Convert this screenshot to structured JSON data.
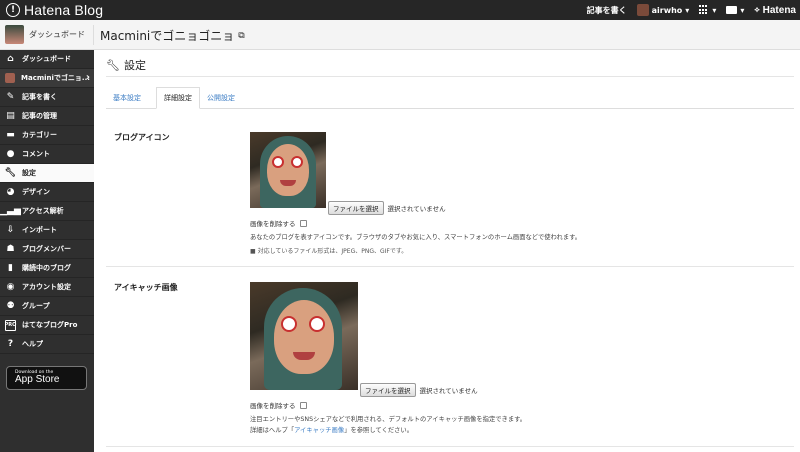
{
  "topbar": {
    "brand": "Hatena Blog",
    "write_label": "記事を書く",
    "user_name": "airwho",
    "user_caret": "▾",
    "menu_caret": "▾",
    "hatena_label": "Hatena"
  },
  "subheader": {
    "dashboard_label": "ダッシュボード",
    "blog_title": "Macminiでゴニョゴニョ"
  },
  "sidebar": {
    "items": [
      {
        "label": "ダッシュボード"
      },
      {
        "label": "Macminiでゴニョ..."
      },
      {
        "label": "記事を書く"
      },
      {
        "label": "記事の管理"
      },
      {
        "label": "カテゴリー"
      },
      {
        "label": "コメント"
      },
      {
        "label": "設定"
      },
      {
        "label": "デザイン"
      },
      {
        "label": "アクセス解析"
      },
      {
        "label": "インポート"
      },
      {
        "label": "ブログメンバー"
      },
      {
        "label": "購読中のブログ"
      },
      {
        "label": "アカウント設定"
      },
      {
        "label": "グループ"
      },
      {
        "label": "はてなブログPro"
      },
      {
        "label": "ヘルプ"
      }
    ],
    "appstore": {
      "small": "Download on the",
      "big": "App Store"
    }
  },
  "main": {
    "title": "設定",
    "tabs": [
      {
        "label": "基本設定"
      },
      {
        "label": "詳細設定"
      },
      {
        "label": "公開設定"
      }
    ],
    "blog_icon": {
      "label": "ブログアイコン",
      "file_button": "ファイルを選択",
      "file_status": "選択されていません",
      "delete_label": "画像を削除する",
      "description": "あなたのブログを表すアイコンです。ブラウザのタブやお気に入り、スマートフォンのホーム画面などで使われます。",
      "formats": "■ 対応しているファイル形式は、JPEG、PNG、GIFです。"
    },
    "eyecatch": {
      "label": "アイキャッチ画像",
      "file_button": "ファイルを選択",
      "file_status": "選択されていません",
      "delete_label": "画像を削除する",
      "description": "注目エントリーやSNSシェアなどで利用される、デフォルトのアイキャッチ画像を指定できます。",
      "help_prefix": "詳細はヘルプ「",
      "help_link": "アイキャッチ画像",
      "help_suffix": "」を参照してください。"
    }
  },
  "colors": {
    "topbar": "#262626",
    "sidebar": "#2f2f2f",
    "link": "#3b7cc4"
  }
}
